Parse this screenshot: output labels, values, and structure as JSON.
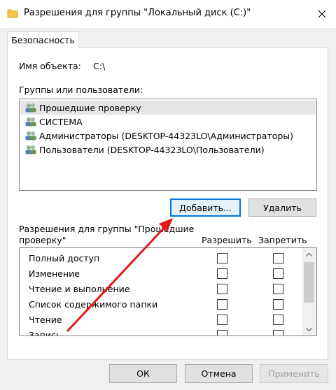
{
  "window": {
    "title": "Разрешения для группы \"Локальный диск (C:)\""
  },
  "tab": {
    "label": "Безопасность"
  },
  "object": {
    "label": "Имя объекта:",
    "value": "C:\\"
  },
  "groups": {
    "label": "Группы или пользователи:",
    "items": [
      {
        "label": "Прошедшие проверку",
        "selected": true
      },
      {
        "label": "СИСТЕМА",
        "selected": false
      },
      {
        "label": "Администраторы (DESKTOP-44323LO\\Администраторы)",
        "selected": false
      },
      {
        "label": "Пользователи (DESKTOP-44323LO\\Пользователи)",
        "selected": false
      }
    ]
  },
  "buttons": {
    "add": "Добавить...",
    "remove": "Удалить",
    "ok": "ОК",
    "cancel": "Отмена",
    "apply": "Применить"
  },
  "permissions": {
    "label_line1": "Разрешения для группы \"Прошедшие",
    "label_line2": "проверку\"",
    "allow_header": "Разрешить",
    "deny_header": "Запретить",
    "items": [
      {
        "label": "Полный доступ",
        "allow": false,
        "deny": false
      },
      {
        "label": "Изменение",
        "allow": false,
        "deny": false
      },
      {
        "label": "Чтение и выполнение",
        "allow": false,
        "deny": false
      },
      {
        "label": "Список содержимого папки",
        "allow": false,
        "deny": false
      },
      {
        "label": "Чтение",
        "allow": false,
        "deny": false
      },
      {
        "label": "Запись",
        "allow": false,
        "deny": false
      }
    ]
  },
  "colors": {
    "accent": "#0078d7",
    "annotation_arrow": "#e01a1a",
    "folder_icon": "#f4c542"
  },
  "icons": {
    "title": "folder-icon",
    "user": "users-group-icon",
    "close": "close-icon"
  }
}
